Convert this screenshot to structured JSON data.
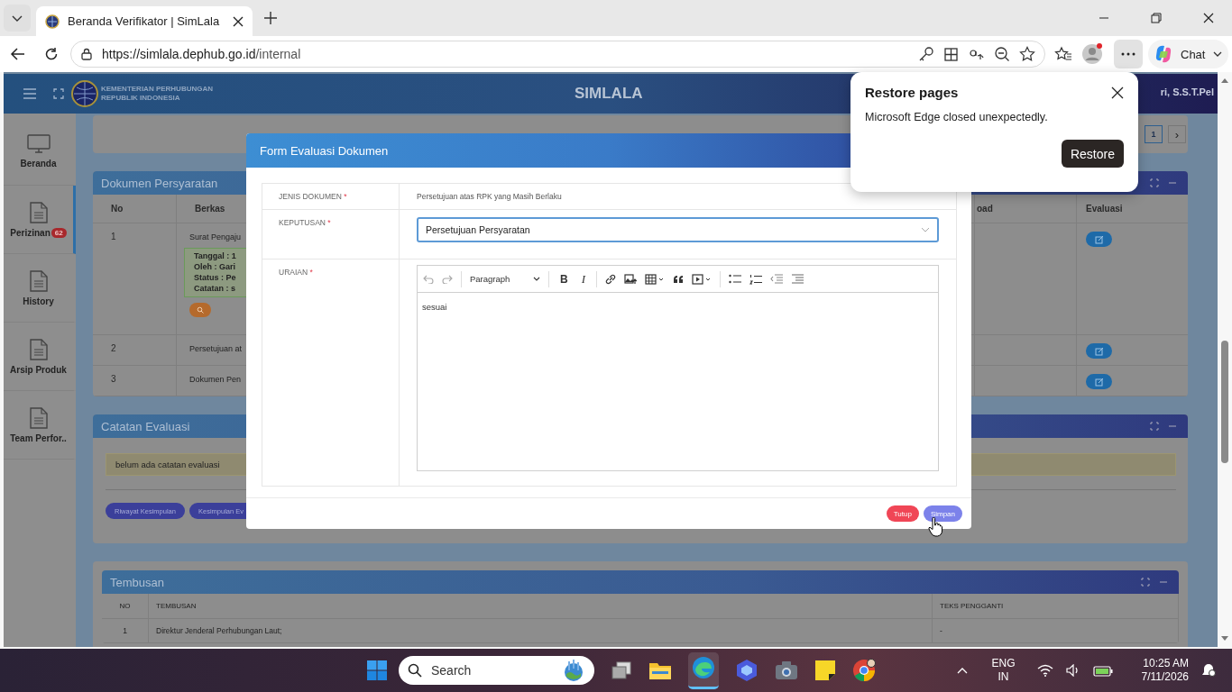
{
  "browser": {
    "tab_title": "Beranda Verifikator | SimLala",
    "url_host": "https://simlala.dephub.go.id",
    "url_path": "/internal",
    "chat_label": "Chat"
  },
  "header": {
    "agency_line1": "KEMENTERIAN PERHUBUNGAN",
    "agency_line2": "REPUBLIK INDONESIA",
    "app_title": "SIMLALA",
    "user_name": "ri, S.S.T.Pel"
  },
  "sidebar": [
    {
      "label": "Beranda",
      "kind": "monitor",
      "selected": false
    },
    {
      "label": "Perizinan",
      "kind": "document",
      "badge": "62",
      "selected": true
    },
    {
      "label": "History",
      "kind": "document",
      "selected": false
    },
    {
      "label": "Arsip Produk",
      "kind": "document",
      "selected": false
    },
    {
      "label": "Team Perfor..",
      "kind": "document",
      "selected": false
    }
  ],
  "pagination": {
    "pages": [
      {
        "label": "1",
        "selected": true
      }
    ],
    "next": "›"
  },
  "documents_panel": {
    "title": "Dokumen Persyaratan",
    "columns": [
      "No",
      "Berkas",
      "oad",
      "Evaluasi"
    ],
    "rows": [
      {
        "no": "1",
        "berkas": "Surat Pengaju",
        "details": [
          "Tanggal : 1",
          "Oleh : Gari",
          "Status : Pe",
          "Catatan : s"
        ]
      },
      {
        "no": "2",
        "berkas": "Persetujuan at"
      },
      {
        "no": "3",
        "berkas": "Dokumen Pen"
      }
    ]
  },
  "notes_panel": {
    "title": "Catatan Evaluasi",
    "empty_text": "belum ada catatan evaluasi",
    "buttons": [
      "Riwayat Kesimpulan",
      "Kesimpulan Ev"
    ]
  },
  "copies_panel": {
    "title": "Tembusan",
    "columns": [
      "NO",
      "TEMBUSAN",
      "TEKS PENGGANTI"
    ],
    "rows": [
      {
        "no": "1",
        "tembusan": "Direktur Jenderal Perhubungan Laut;",
        "teks": "-"
      }
    ]
  },
  "modal": {
    "title": "Form Evaluasi Dokumen",
    "fields": [
      {
        "label": "JENIS DOKUMEN",
        "mark": "*",
        "kind": "text",
        "value": "Persetujuan atas RPK yang Masih Berlaku"
      },
      {
        "label": "KEPUTUSAN",
        "mark": "*",
        "kind": "select",
        "value": "Persetujuan Persyaratan"
      },
      {
        "label": "URAIAN",
        "mark": "*",
        "kind": "editor",
        "value": "sesuai"
      }
    ],
    "editor": {
      "block_format": "Paragraph",
      "bold": "B",
      "italic": "I"
    },
    "buttons": [
      {
        "label": "Tutup",
        "kind": "danger"
      },
      {
        "label": "Simpan",
        "kind": "primary"
      }
    ]
  },
  "restore_popup": {
    "title": "Restore pages",
    "message": "Microsoft Edge closed unexpectedly.",
    "button": "Restore"
  },
  "taskbar": {
    "search_placeholder": "Search",
    "language": "ENG",
    "region": "IN",
    "time": "10:25 AM",
    "date": "7/11/2026"
  }
}
